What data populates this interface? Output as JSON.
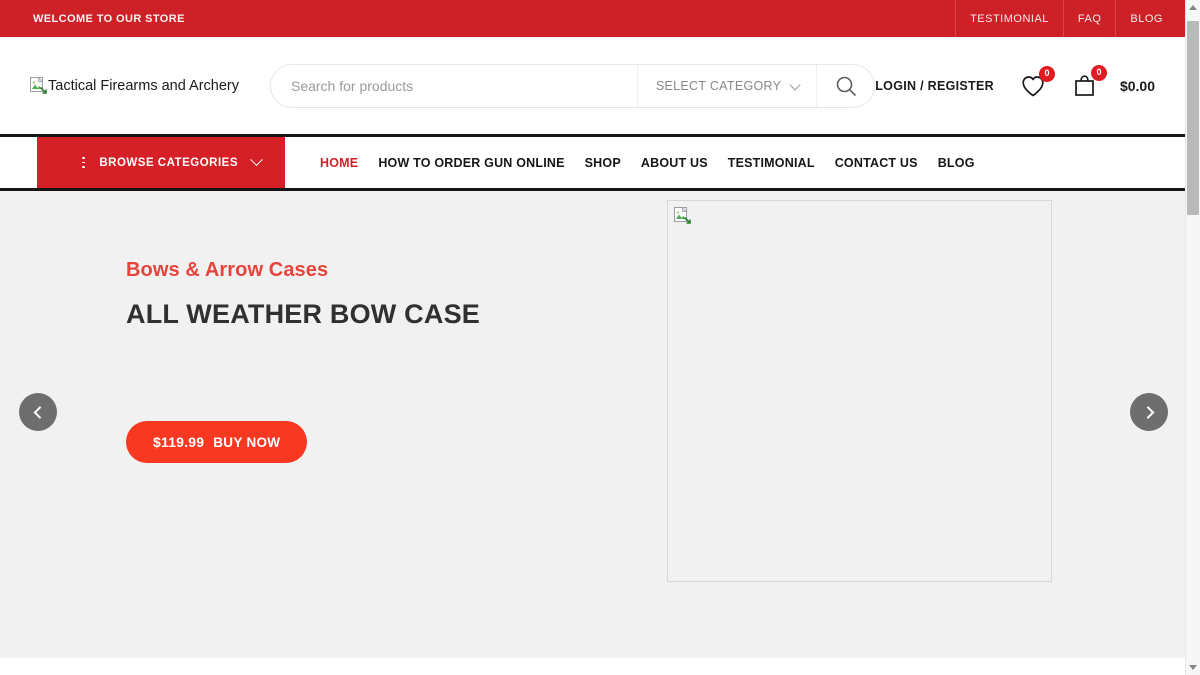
{
  "topbar": {
    "welcome": "WELCOME TO OUR STORE",
    "links": [
      {
        "label": "TESTIMONIAL"
      },
      {
        "label": "FAQ"
      },
      {
        "label": "BLOG"
      }
    ],
    "bg_color": "#cd2027"
  },
  "header": {
    "logo_alt": "Tactical Firearms and Archery",
    "logo_icon": "broken-image-icon",
    "search": {
      "placeholder": "Search for products",
      "value": "",
      "category_label": "SELECT CATEGORY",
      "category_icon": "chevron-down-icon",
      "search_icon": "search-icon"
    },
    "account": {
      "login_label": "LOGIN / REGISTER",
      "wishlist_icon": "heart-icon",
      "wishlist_count": "0",
      "cart_icon": "shopping-bag-icon",
      "cart_count": "0",
      "cart_total": "$0.00"
    }
  },
  "nav": {
    "browse": {
      "label": "BROWSE CATEGORIES",
      "menu_icon": "hamburger-icon",
      "chevron_icon": "chevron-down-icon",
      "bg_color": "#d42026"
    },
    "items": [
      {
        "label": "HOME",
        "active": true
      },
      {
        "label": "HOW TO ORDER GUN ONLINE",
        "active": false
      },
      {
        "label": "SHOP",
        "active": false
      },
      {
        "label": "ABOUT US",
        "active": false
      },
      {
        "label": "TESTIMONIAL",
        "active": false
      },
      {
        "label": "CONTACT US",
        "active": false
      },
      {
        "label": "BLOG",
        "active": false
      }
    ],
    "active_color": "#d42026"
  },
  "hero": {
    "subtitle": "Bows & Arrow Cases",
    "title": "ALL WEATHER BOW CASE",
    "price": "$119.99",
    "cta": "BUY NOW",
    "button_color": "#f93822",
    "subtitle_color": "#e7443b",
    "background_color": "#f1f1f1",
    "image_alt": "",
    "image_icon": "broken-image-icon",
    "prev_icon": "chevron-left-icon",
    "next_icon": "chevron-right-icon"
  },
  "scrollbar": {
    "up_icon": "scroll-up-arrow-icon",
    "down_icon": "scroll-down-arrow-icon",
    "thumb": "scrollbar-thumb"
  }
}
